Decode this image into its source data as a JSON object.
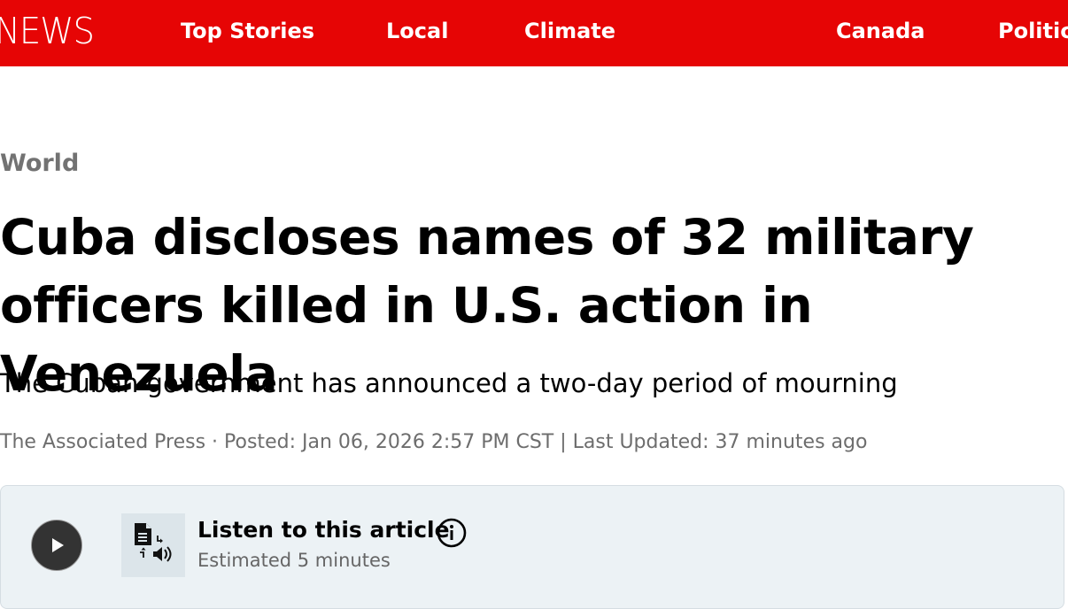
{
  "nav": {
    "brand": "NEWS",
    "items": [
      {
        "label": "Top Stories"
      },
      {
        "label": "Local"
      },
      {
        "label": "Climate"
      },
      {
        "label": "Canada"
      },
      {
        "label": "Politic"
      }
    ],
    "faded_item_label": "",
    "background_color": "#e60505"
  },
  "article": {
    "section": "World",
    "headline": "Cuba discloses names of 32 military officers killed in U.S. action in Venezuela",
    "deck": "The Cuban government has announced a two-day period of mourning",
    "byline": "The Associated Press · Posted: Jan 06, 2026 2:57 PM CST | Last Updated: 37 minutes ago"
  },
  "listen": {
    "title": "Listen to this article",
    "estimate": "Estimated 5 minutes",
    "play_icon": "play-icon",
    "tts_icon": "text-to-speech-icon",
    "info_icon": "info-icon"
  }
}
